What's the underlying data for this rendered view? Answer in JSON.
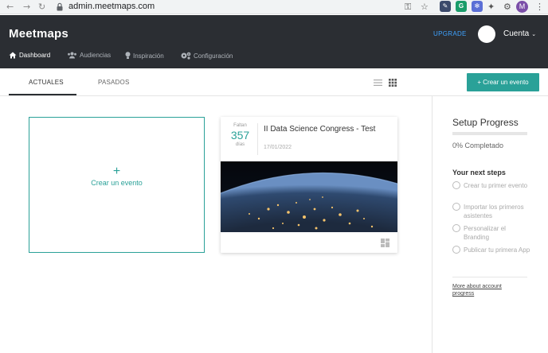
{
  "browser": {
    "url": "admin.meetmaps.com",
    "profile_initial": "M"
  },
  "header": {
    "brand": "Meetmaps",
    "upgrade": "UPGRADE",
    "account": "Cuenta"
  },
  "nav": {
    "items": [
      {
        "label": "Dashboard",
        "icon": "home-icon",
        "active": true
      },
      {
        "label": "Audiencias",
        "icon": "users-icon",
        "active": false
      },
      {
        "label": "Inspiración",
        "icon": "lightbulb-icon",
        "active": false
      },
      {
        "label": "Configuración",
        "icon": "gears-icon",
        "active": false
      }
    ]
  },
  "tabs": {
    "actuales": "ACTUALES",
    "pasados": "PASADOS",
    "create_button": "+ Crear un evento"
  },
  "main": {
    "create_card_label": "Crear un evento",
    "event": {
      "faltan": "Faltan",
      "days_count": "357",
      "dias": "días",
      "title": "II Data Science Congress - Test",
      "date": "17/01/2022"
    }
  },
  "sidebar": {
    "title": "Setup Progress",
    "progress_text": "0% Completado",
    "progress_fraction": 0,
    "next_steps_title": "Your next steps",
    "steps": [
      "Crear tu primer evento",
      "Importar los primeros asistentes",
      "Personalizar el Branding",
      "Publicar tu primera App"
    ],
    "account_link": "More about account progress"
  },
  "colors": {
    "accent": "#2aa198",
    "header_bg": "#2b2e33",
    "upgrade": "#3ea2ff"
  }
}
